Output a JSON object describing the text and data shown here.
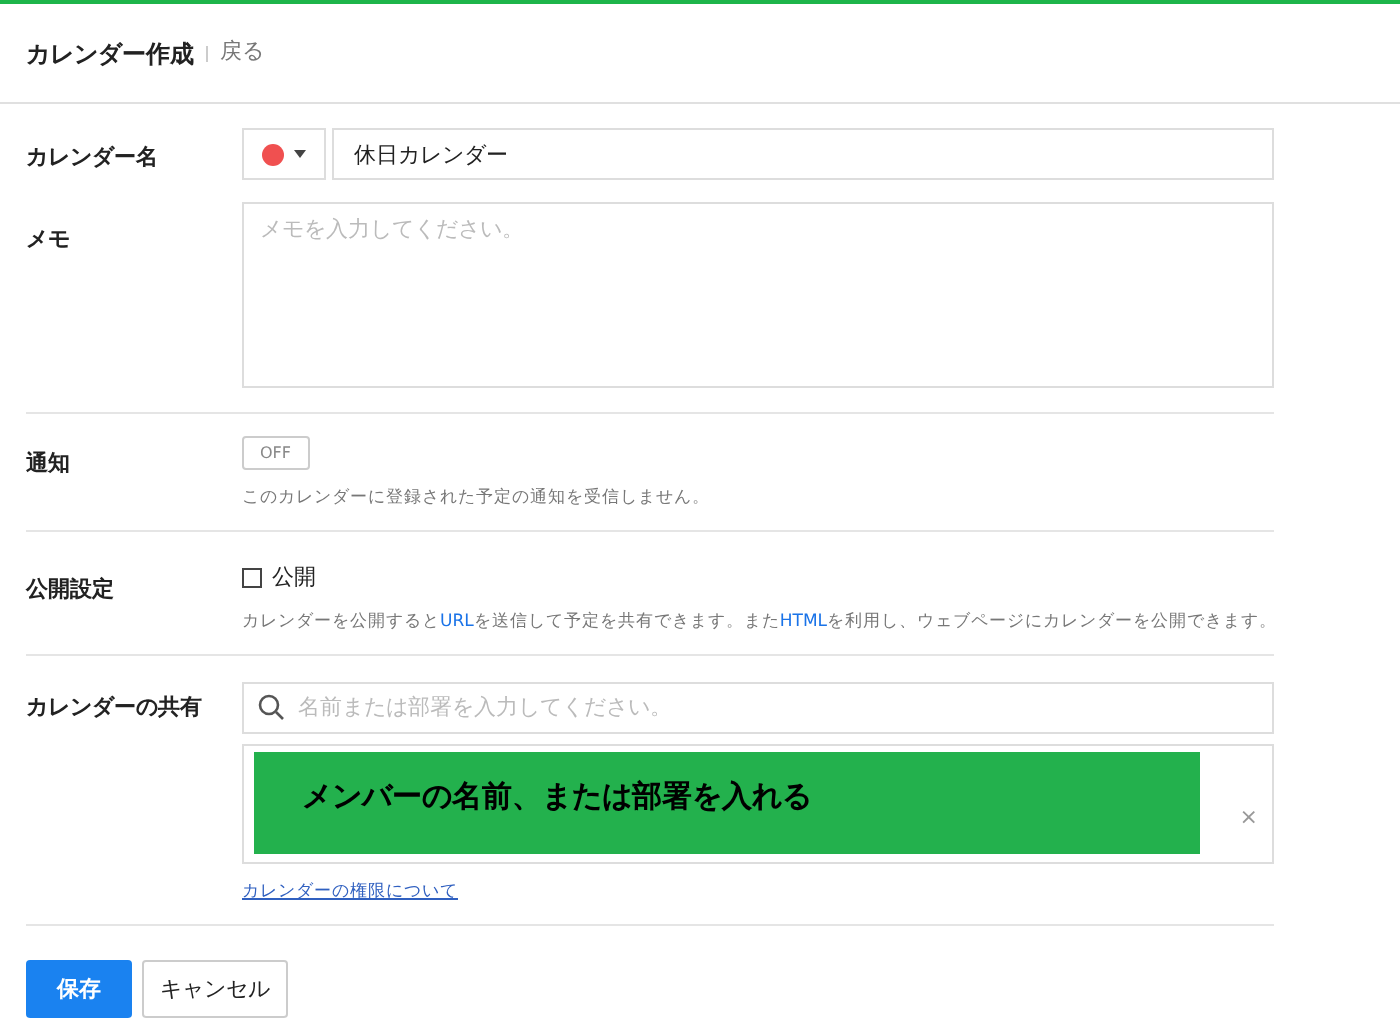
{
  "header": {
    "title": "カレンダー作成",
    "back_link": "戻る"
  },
  "name_row": {
    "label": "カレンダー名",
    "color": "#f05050",
    "value": "休日カレンダー"
  },
  "memo_row": {
    "label": "メモ",
    "placeholder": "メモを入力してください。"
  },
  "notify_row": {
    "label": "通知",
    "toggle": {
      "text": "OFF",
      "on": false
    },
    "description": "このカレンダーに登録された予定の通知を受信しません。"
  },
  "public_row": {
    "label": "公開設定",
    "checkbox": {
      "text": "公開",
      "checked": false
    },
    "description": [
      {
        "kind": "text",
        "text": "カレンダーを公開すると"
      },
      {
        "kind": "highlight",
        "text": "URL"
      },
      {
        "kind": "text",
        "text": "を送信して予定を共有できます。また"
      },
      {
        "kind": "highlight",
        "text": "HTML"
      },
      {
        "kind": "text",
        "text": "を利用し、ウェブページにカレンダーを公開できます。"
      }
    ]
  },
  "share_row": {
    "label": "カレンダーの共有",
    "search_placeholder": "名前または部署を入力してください。",
    "banner": "メンバーの名前、または部署を入れる",
    "clear_icon": "×",
    "link": "カレンダーの権限について"
  },
  "buttons": [
    {
      "label": "保存",
      "kind": "primary"
    },
    {
      "label": "キャンセル",
      "kind": "secondary"
    }
  ]
}
